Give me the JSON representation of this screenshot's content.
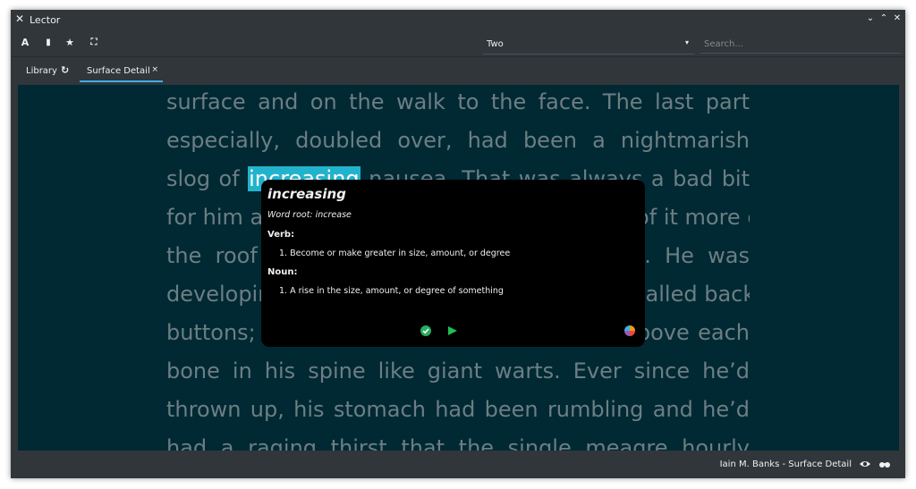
{
  "window": {
    "title": "Lector",
    "app_icon": "x-logo-icon",
    "controls": [
      "minimize",
      "maximize",
      "close"
    ],
    "control_glyphs": {
      "minimize": "⌄",
      "maximize": "⌃",
      "close": "✕"
    }
  },
  "toolbar": {
    "buttons": [
      {
        "name": "font-settings-icon",
        "glyph": "A"
      },
      {
        "name": "bookmark-icon",
        "glyph": "▮"
      },
      {
        "name": "star-icon",
        "glyph": "★"
      },
      {
        "name": "fullscreen-icon",
        "glyph": "⛶"
      }
    ],
    "view_select": {
      "value": "Two",
      "arrow": "▾"
    },
    "search": {
      "placeholder": "Search...",
      "value": ""
    }
  },
  "tabs": [
    {
      "label": "Library",
      "icon": "refresh-icon",
      "icon_glyph": "↻",
      "active": false
    },
    {
      "label": "Surface Detail",
      "close_glyph": "×",
      "active": true
    }
  ],
  "reader": {
    "lines": [
      "surface and on the walk to the face. The last part",
      "especially, doubled over, had been a nightmarish",
      "slog of |increasing| nausea. That was always a bad bit",
      "for him and for once his turn to carry some of it more of",
      "the roof hurting him more than Nathan’s. He was",
      "developing pain in bumps like fat rounded, called back",
      "buttons; he could feel them standing out above each",
      "bone in his spine like giant warts. Ever since he’d",
      "thrown up, his stomach had been rumbling and he’d",
      "had a raging thirst that the single meagre hourly"
    ],
    "highlighted_word": "increasing",
    "colors": {
      "background": "#002933",
      "text": "#6c7e84",
      "highlight": "#22b3cc"
    }
  },
  "dictionary_popup": {
    "word": "increasing",
    "word_root": "Word root: increase",
    "verb_header": "Verb",
    "verb_definition": "1. Become or make greater in size, amount, or degree",
    "noun_header": "Noun",
    "noun_definition": "1. A rise in the size, amount, or degree of something",
    "icons": [
      "check-icon",
      "play-icon",
      "color-wheel-icon"
    ]
  },
  "statusbar": {
    "book": "Iain M. Banks - Surface Detail",
    "icons": [
      "eye-icon",
      "glasses-icon"
    ]
  }
}
